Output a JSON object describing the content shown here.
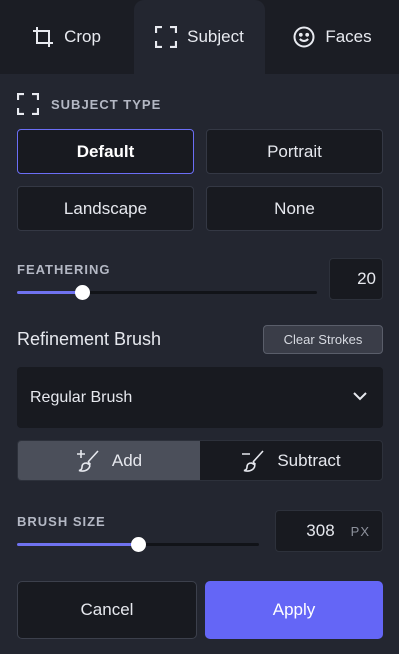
{
  "tabs": [
    {
      "label": "Crop",
      "icon": "crop-icon"
    },
    {
      "label": "Subject",
      "icon": "subject-icon",
      "active": true
    },
    {
      "label": "Faces",
      "icon": "smile-icon"
    }
  ],
  "subject_type": {
    "heading": "SUBJECT TYPE",
    "options": [
      "Default",
      "Portrait",
      "Landscape",
      "None"
    ],
    "selected": "Default"
  },
  "feathering": {
    "label": "FEATHERING",
    "value": "20",
    "slider_fraction": 0.215
  },
  "refinement": {
    "title": "Refinement Brush",
    "clear_label": "Clear Strokes",
    "brush_select": "Regular Brush",
    "mode_add": "Add",
    "mode_subtract": "Subtract",
    "active_mode": "Add"
  },
  "brush_size": {
    "label": "BRUSH SIZE",
    "value": "308",
    "unit": "PX",
    "slider_fraction": 0.5
  },
  "footer": {
    "cancel_label": "Cancel",
    "apply_label": "Apply"
  },
  "colors": {
    "accent": "#6466f6",
    "background": "#232630",
    "panel": "#181a20"
  }
}
